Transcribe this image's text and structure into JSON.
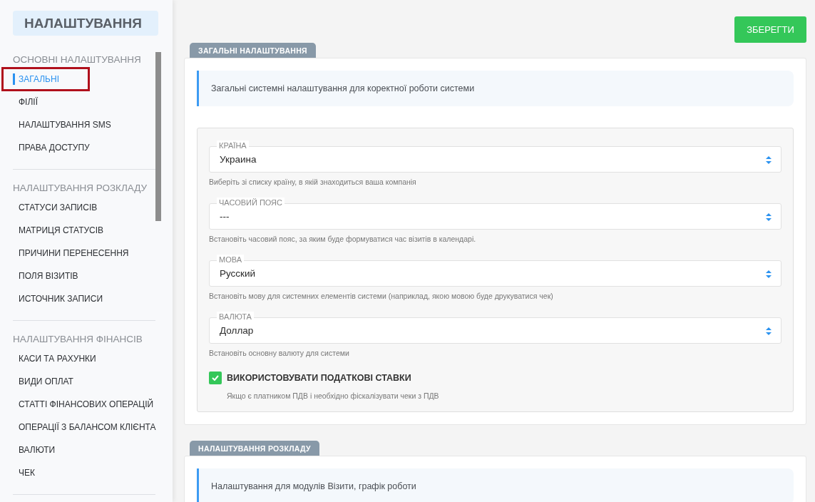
{
  "sidebar": {
    "title": "НАЛАШТУВАННЯ",
    "groups": [
      {
        "heading": "ОСНОВНІ НАЛАШТУВАННЯ",
        "items": [
          {
            "label": "ЗАГАЛЬНІ",
            "selected": true,
            "highlighted": true
          },
          {
            "label": "ФІЛІЇ",
            "selected": false,
            "highlighted": false
          },
          {
            "label": "НАЛАШТУВАННЯ SMS",
            "selected": false,
            "highlighted": false
          },
          {
            "label": "ПРАВА ДОСТУПУ",
            "selected": false,
            "highlighted": false
          }
        ]
      },
      {
        "heading": "НАЛАШТУВАННЯ РОЗКЛАДУ",
        "items": [
          {
            "label": "СТАТУСИ ЗАПИСІВ",
            "selected": false,
            "highlighted": false
          },
          {
            "label": "МАТРИЦЯ СТАТУСІВ",
            "selected": false,
            "highlighted": false
          },
          {
            "label": "ПРИЧИНИ ПЕРЕНЕСЕННЯ",
            "selected": false,
            "highlighted": false
          },
          {
            "label": "ПОЛЯ ВІЗИТІВ",
            "selected": false,
            "highlighted": false
          },
          {
            "label": "ИСТОЧНИК ЗАПИСИ",
            "selected": false,
            "highlighted": false
          }
        ]
      },
      {
        "heading": "НАЛАШТУВАННЯ ФІНАНСІВ",
        "items": [
          {
            "label": "КАСИ ТА РАХУНКИ",
            "selected": false,
            "highlighted": false
          },
          {
            "label": "ВИДИ ОПЛАТ",
            "selected": false,
            "highlighted": false
          },
          {
            "label": "СТАТТІ ФІНАНСОВИХ ОПЕРАЦІЙ",
            "selected": false,
            "highlighted": false
          },
          {
            "label": "ОПЕРАЦІЇ З БАЛАНСОМ КЛІЄНТА",
            "selected": false,
            "highlighted": false
          },
          {
            "label": "ВАЛЮТИ",
            "selected": false,
            "highlighted": false
          },
          {
            "label": "ЧЕК",
            "selected": false,
            "highlighted": false
          }
        ]
      }
    ]
  },
  "save_button": "ЗБЕРЕГТИ",
  "sections": [
    {
      "tab": "ЗАГАЛЬНІ НАЛАШТУВАННЯ",
      "info": "Загальні системні налаштування для коректної роботи системи",
      "fields": [
        {
          "kind": "select",
          "label": "КРАЇНА",
          "value": "Украина",
          "hint": "Виберіть зі списку країну, в якій знаходиться ваша компанія"
        },
        {
          "kind": "select",
          "label": "ЧАСОВИЙ ПОЯС",
          "value": "---",
          "hint": "Встановіть часовий пояс, за яким буде формуватися час візитів в календарі."
        },
        {
          "kind": "select",
          "label": "МОВА",
          "value": "Русский",
          "hint": "Встановіть мову для системних елементів системи (наприклад, якою мовою буде друкуватися чек)"
        },
        {
          "kind": "select",
          "label": "ВАЛЮТА",
          "value": "Доллар",
          "hint": "Встановіть основну валюту для системи"
        },
        {
          "kind": "checkbox",
          "label": "ВИКОРИСТОВУВАТИ ПОДАТКОВІ СТАВКИ",
          "checked": true,
          "hint": "Якщо є платником ПДВ і необхідно фіскалізувати чеки з ПДВ"
        }
      ]
    },
    {
      "tab": "НАЛАШТУВАННЯ РОЗКЛАДУ",
      "info": "Налаштування для модулів Візити, графік роботи"
    }
  ]
}
